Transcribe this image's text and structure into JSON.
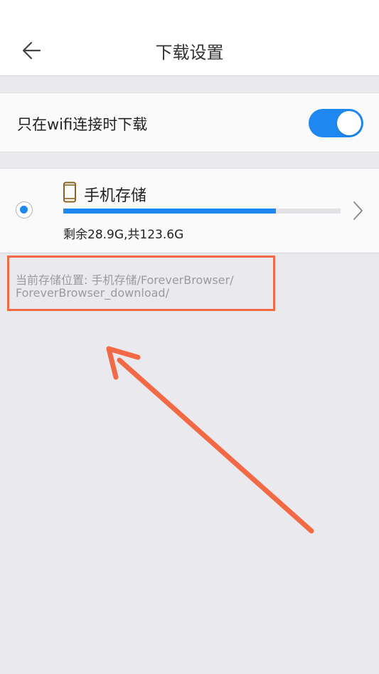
{
  "header": {
    "title": "下载设置",
    "back_icon": "arrow-left-icon"
  },
  "settings": {
    "wifi_only_label": "只在wifi连接时下载",
    "wifi_only_enabled": true
  },
  "storage": {
    "name": "手机存储",
    "icon": "phone-icon",
    "selected": true,
    "usage_text": "剩余28.9G,共123.6G",
    "used_fraction": 0.766
  },
  "current_location": {
    "line1": "当前存储位置: 手机存储/ForeverBrowser/",
    "line2": "ForeverBrowser_download/"
  },
  "annotation": {
    "color": "#f26a45"
  },
  "colors": {
    "accent": "#1e88f0",
    "phone_icon": "#8a6420"
  }
}
